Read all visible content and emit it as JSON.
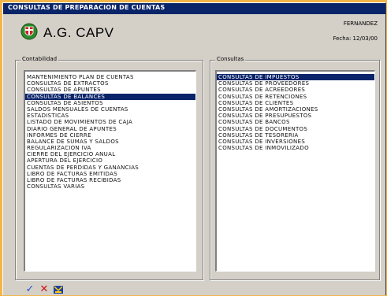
{
  "window": {
    "title": "CONSULTAS DE PREPARACION DE CUENTAS"
  },
  "header": {
    "company": "A.G. CAPV",
    "user": "FERNANDEZ",
    "date": "Fecha: 12/03/00"
  },
  "left_group": {
    "label": "Contabilidad",
    "items": [
      "MANTENIMIENTO PLAN DE CUENTAS",
      "CONSULTAS DE EXTRACTOS",
      "CONSULTAS DE APUNTES",
      "CONSULTAS DE BALANCES",
      "CONSULTAS DE ASIENTOS",
      "SALDOS MENSUALES DE CUENTAS",
      "ESTADISTICAS",
      "LISTADO DE MOVIMIENTOS DE CAJA",
      "DIARIO GENERAL DE APUNTES",
      "INFORMES DE CIERRE",
      "BALANCE DE SUMAS Y SALDOS",
      "REGULARIZACION IVA",
      "CIERRE DEL EJERCICIO ANUAL",
      "APERTURA DEL EJERCICIO",
      "CUENTAS DE PERDIDAS Y GANANCIAS",
      "LIBRO DE FACTURAS EMITIDAS",
      "LIBRO DE FACTURAS RECIBIDAS",
      "CONSULTAS VARIAS"
    ],
    "selected_index": 3
  },
  "right_group": {
    "label": "Consultas",
    "items": [
      "CONSULTAS DE IMPUESTOS",
      "CONSULTAS DE PROVEEDORES",
      "CONSULTAS DE ACREEDORES",
      "CONSULTAS DE RETENCIONES",
      "CONSULTAS DE CLIENTES",
      "CONSULTAS DE AMORTIZACIONES",
      "CONSULTAS DE PRESUPUESTOS",
      "CONSULTAS DE BANCOS",
      "CONSULTAS DE DOCUMENTOS",
      "CONSULTAS DE TESORERIA",
      "CONSULTAS DE INVERSIONES",
      "CONSULTAS DE INMOVILIZADO"
    ],
    "selected_index": 0
  },
  "toolbar": {
    "ok_icon": "check-icon",
    "cancel_icon": "x-icon",
    "report_icon": "report-icon",
    "ok_glyph": "✓",
    "cancel_glyph": "✕"
  },
  "colors": {
    "accent": "#0a246a",
    "background": "#f3b54b",
    "face": "#d4d0c8"
  }
}
